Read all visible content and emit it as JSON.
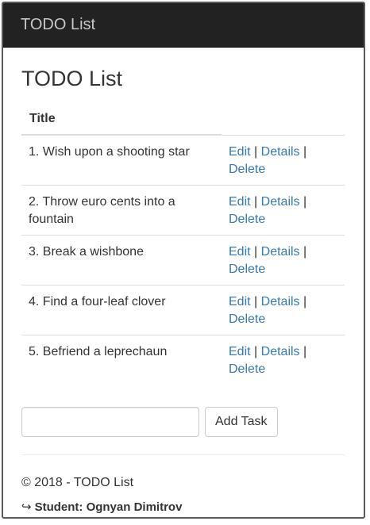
{
  "navbar": {
    "brand": "TODO List"
  },
  "main": {
    "title": "TODO List",
    "table": {
      "header": "Title",
      "rows": [
        {
          "title": "1. Wish upon a shooting star"
        },
        {
          "title": "2. Throw euro cents into a fountain"
        },
        {
          "title": "3. Break a wishbone"
        },
        {
          "title": "4. Find a four-leaf clover"
        },
        {
          "title": "5. Befriend a leprechaun"
        }
      ],
      "actions": {
        "edit": "Edit",
        "details": "Details",
        "delete": "Delete",
        "separator": "|"
      }
    },
    "add_form": {
      "input_value": "",
      "button_label": "Add Task"
    }
  },
  "footer": {
    "copyright": "© 2018 - TODO List",
    "student_icon": "↪",
    "student_label": "Student: Ognyan Dimitrov"
  },
  "colors": {
    "navbar_bg": "#222222",
    "link": "#337ab7",
    "text": "#333333"
  }
}
